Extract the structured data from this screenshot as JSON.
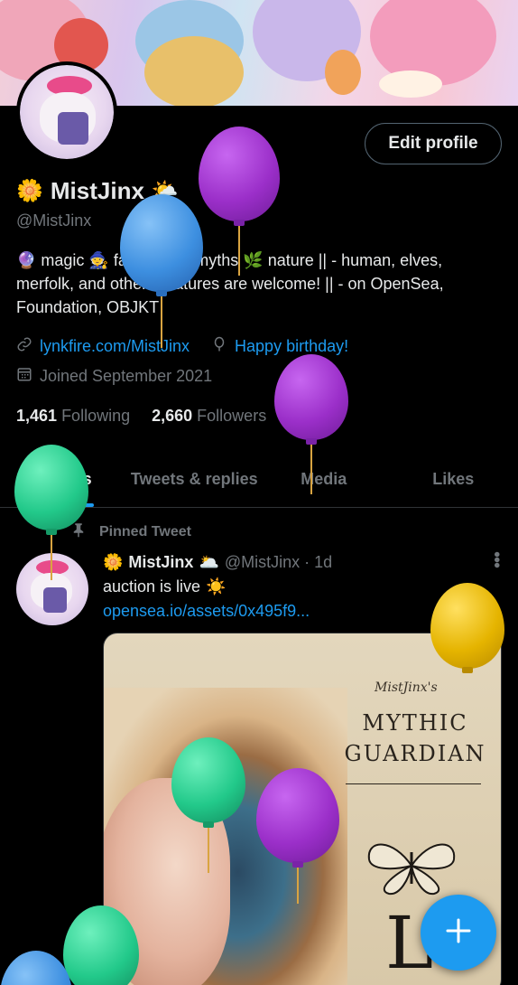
{
  "profile": {
    "display_name": "MistJinx",
    "name_emoji_left": "🌼",
    "name_emoji_right": "🌤️",
    "handle": "@MistJinx",
    "bio": "🔮 magic 🧙 fantasy 🦄 myths 🌿 nature || - human, elves, merfolk, and other creatures are welcome! || - on OpenSea, Foundation, OBJKT",
    "website": "lynkfire.com/MistJinx",
    "birthday": "Happy birthday!",
    "joined": "Joined September 2021",
    "following_count": "1,461",
    "following_label": "Following",
    "followers_count": "2,660",
    "followers_label": "Followers",
    "edit_label": "Edit profile"
  },
  "tabs": [
    {
      "label": "Tweets"
    },
    {
      "label": "Tweets & replies"
    },
    {
      "label": "Media"
    },
    {
      "label": "Likes"
    }
  ],
  "pinned_tweet": {
    "pinned_label": "Pinned Tweet",
    "author_emoji_left": "🌼",
    "author_name": "MistJinx",
    "author_emoji_right": "🌥️",
    "author_handle": "@MistJinx · 1d",
    "text": "auction is live",
    "text_emoji": "☀️",
    "link": "opensea.io/assets/0x495f9...",
    "media": {
      "small_title": "MistJinx's",
      "title_line1": "MYTHIC",
      "title_line2": "GUARDIAN",
      "big_letter": "L"
    }
  },
  "icons": {
    "link": "link-icon",
    "balloon": "balloon-icon",
    "calendar": "calendar-icon",
    "pin": "pin-icon",
    "more": "more-icon",
    "compose": "plus-icon"
  },
  "colors": {
    "accent": "#1d9bf0",
    "background": "#000000",
    "muted": "#71767b",
    "balloon_purple": "#9b2fc9",
    "balloon_blue": "#3d8fe0",
    "balloon_green": "#22c98a",
    "balloon_yellow": "#e5b400"
  }
}
